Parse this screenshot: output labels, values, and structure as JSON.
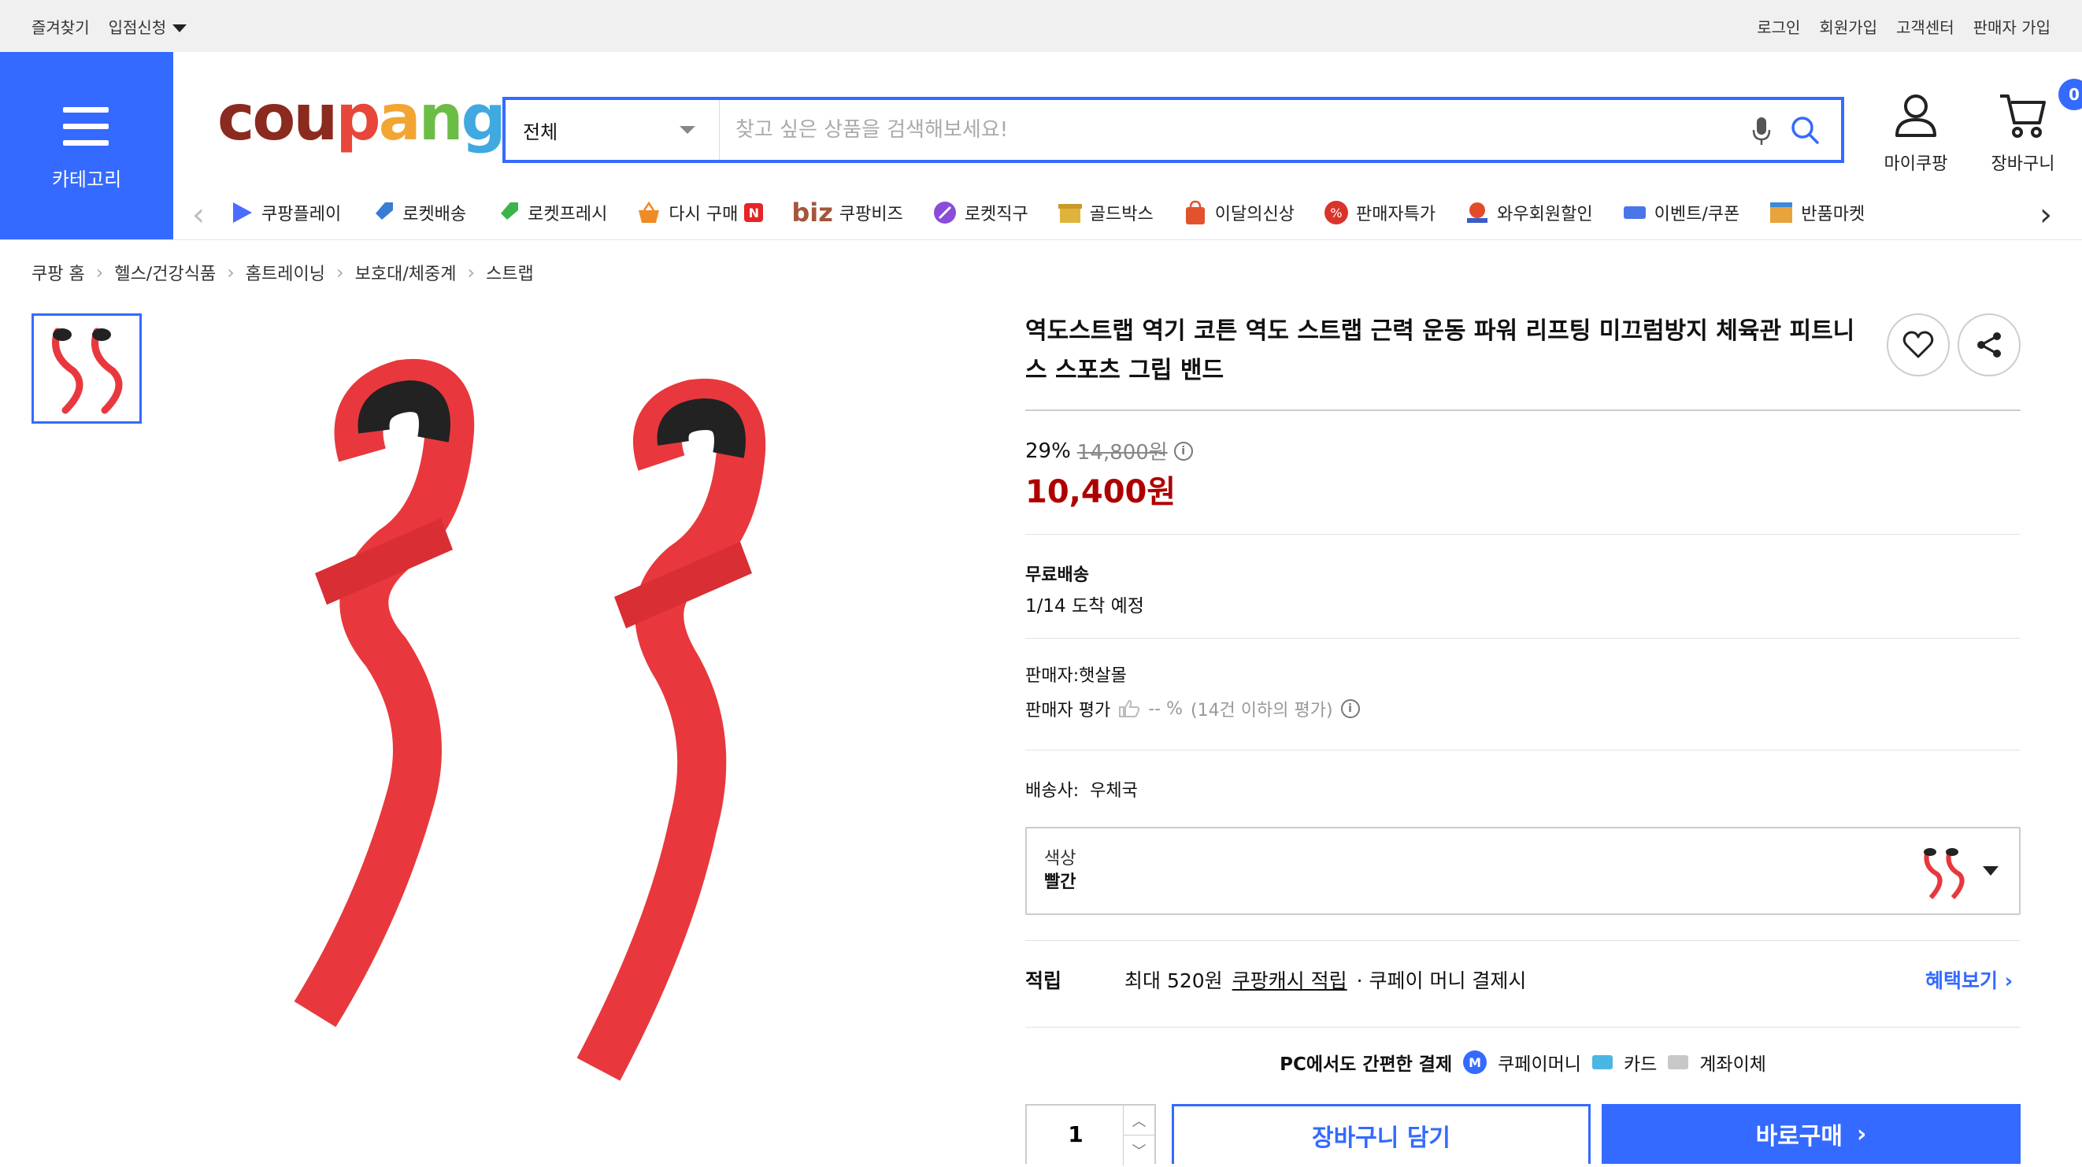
{
  "topbar": {
    "left": [
      "즐겨찾기",
      "입점신청"
    ],
    "right": [
      "로그인",
      "회원가입",
      "고객센터",
      "판매자 가입"
    ]
  },
  "header": {
    "category_label": "카테고리",
    "logo": {
      "c": "c",
      "o": "o",
      "u": "u",
      "p": "p",
      "a": "a",
      "n": "n",
      "g": "g"
    },
    "search_category": "전체",
    "search_placeholder": "찾고 싶은 상품을 검색해보세요!",
    "my_label": "마이쿠팡",
    "cart_label": "장바구니",
    "cart_count": "0"
  },
  "nav": [
    {
      "label": "쿠팡플레이",
      "icon": "play-icon",
      "color": "#4a6cff"
    },
    {
      "label": "로켓배송",
      "icon": "rocket-icon",
      "color": "#3a7bd5"
    },
    {
      "label": "로켓프레시",
      "icon": "rocket-fresh-icon",
      "color": "#3bb54a"
    },
    {
      "label": "다시 구매",
      "icon": "basket-icon",
      "color": "#f08a24"
    },
    {
      "label": "쿠팡비즈",
      "icon": "biz-logo",
      "color": "#a4553b"
    },
    {
      "label": "로켓직구",
      "icon": "rocket-global-icon",
      "color": "#8b4cd9"
    },
    {
      "label": "골드박스",
      "icon": "gold-box-icon",
      "color": "#e0b43c"
    },
    {
      "label": "이달의신상",
      "icon": "new-bag-icon",
      "color": "#e2532d"
    },
    {
      "label": "판매자특가",
      "icon": "percent-icon",
      "color": "#d9342b"
    },
    {
      "label": "와우회원할인",
      "icon": "wow-icon",
      "color": "#e24a2b"
    },
    {
      "label": "이벤트/쿠폰",
      "icon": "coupon-icon",
      "color": "#4a76e8"
    },
    {
      "label": "반품마켓",
      "icon": "return-market-icon",
      "color": "#e8a33c"
    }
  ],
  "nav_badge": "N",
  "nav_biz_prefix": "biz",
  "breadcrumb": [
    "쿠팡 홈",
    "헬스/건강식품",
    "홈트레이닝",
    "보호대/체중계",
    "스트랩"
  ],
  "product": {
    "title": "역도스트랩 역기 코튼 역도 스트랩 근력 운동 파워 리프팅 미끄럼방지 체육관 피트니스 스포츠 그립 밴드",
    "discount_rate": "29%",
    "original_price": "14,800원",
    "price": "10,400원",
    "shipping_title": "무료배송",
    "shipping_date": "1/14 도착 예정",
    "seller": "판매자:햇살몰",
    "seller_rating_label": "판매자 평가",
    "seller_rating_value": "-- %",
    "seller_rating_note": "(14건 이하의 평가)",
    "carrier": "배송사:  우체국",
    "option_key": "색상",
    "option_value": "빨간",
    "reward_key": "적립",
    "reward_text": "최대 520원",
    "reward_link_text": "쿠팡캐시 적립",
    "reward_suffix": "· 쿠페이 머니 결제시",
    "benefit_link": "혜택보기",
    "pc_pay_title": "PC에서도 간편한 결제",
    "pay_methods": [
      "쿠페이머니",
      "카드",
      "계좌이체"
    ],
    "pay_money_icon": "M",
    "quantity": "1",
    "add_cart_label": "장바구니 담기",
    "buy_now_label": "바로구매"
  },
  "colors": {
    "accent": "#346aff",
    "price": "#ae0000",
    "strap": "#e8383d"
  }
}
